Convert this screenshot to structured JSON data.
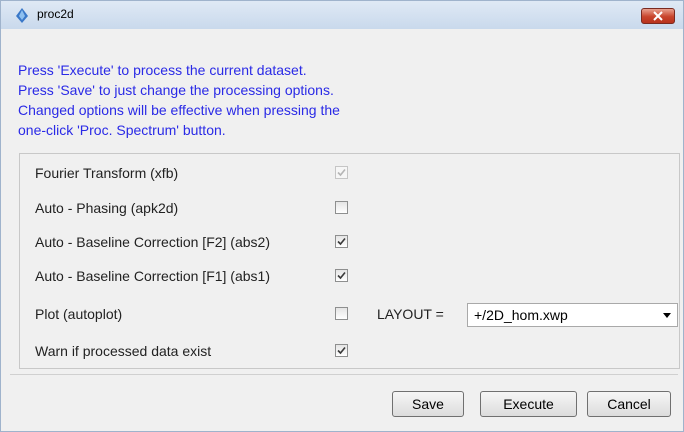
{
  "window": {
    "title": "proc2d"
  },
  "info": {
    "lines": [
      "Press 'Execute' to process the current dataset.",
      "Press 'Save' to just change the processing options.",
      "Changed options will be effective when pressing the",
      "one-click 'Proc. Spectrum' button."
    ]
  },
  "options": [
    {
      "label": "Fourier Transform (xfb)",
      "checked": true,
      "enabled": false
    },
    {
      "label": "Auto - Phasing (apk2d)",
      "checked": false,
      "enabled": true
    },
    {
      "label": "Auto - Baseline Correction [F2] (abs2)",
      "checked": true,
      "enabled": true
    },
    {
      "label": "Auto - Baseline Correction [F1] (abs1)",
      "checked": true,
      "enabled": true
    },
    {
      "label": "Plot (autoplot)",
      "checked": false,
      "enabled": true
    },
    {
      "label": "Warn if processed data exist",
      "checked": true,
      "enabled": true
    }
  ],
  "layout": {
    "label": "LAYOUT =",
    "value": "+/2D_hom.xwp"
  },
  "buttons": {
    "save": "Save",
    "execute": "Execute",
    "cancel": "Cancel"
  },
  "colors": {
    "info_text": "#2a2ae6",
    "close_button": "#c8442c",
    "titlebar": "#d3e1f1"
  }
}
